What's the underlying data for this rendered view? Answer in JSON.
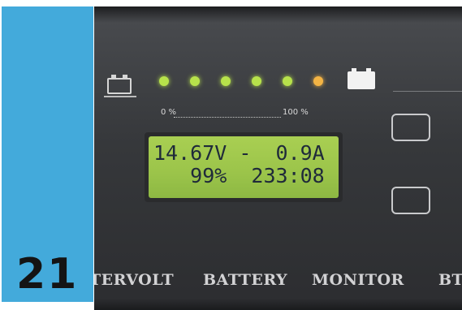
{
  "page_number": "21",
  "monitor": {
    "scale": {
      "min_label": "0 %",
      "max_label": "100 %"
    },
    "leds": [
      {
        "color": "#b7e24b",
        "lit": true
      },
      {
        "color": "#b7e24b",
        "lit": true
      },
      {
        "color": "#b7e24b",
        "lit": true
      },
      {
        "color": "#b7e24b",
        "lit": true
      },
      {
        "color": "#b7e24b",
        "lit": true
      },
      {
        "color": "#f4b444",
        "lit": true
      }
    ],
    "display": {
      "line1": "14.67V -  0.9A",
      "line2": "   99%  233:08"
    },
    "brand": {
      "word1": "TERVOLT",
      "word2": "BATTERY",
      "word3": "MONITOR",
      "word4": "BT"
    }
  },
  "colors": {
    "tab": "#43aadb",
    "lcd_background": "#a9cf52",
    "lcd_text": "#1f2a3a"
  }
}
